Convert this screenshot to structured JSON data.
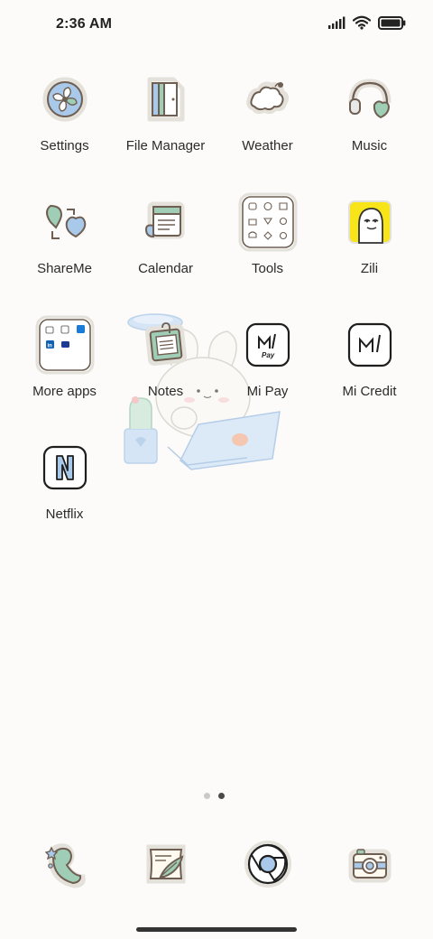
{
  "status_bar": {
    "time": "2:36 AM",
    "signal_icon": "signal-bars-icon",
    "wifi_icon": "wifi-icon",
    "battery_icon": "battery-icon"
  },
  "apps": [
    {
      "label": "Settings",
      "icon": "settings-icon"
    },
    {
      "label": "File Manager",
      "icon": "file-manager-icon"
    },
    {
      "label": "Weather",
      "icon": "weather-icon"
    },
    {
      "label": "Music",
      "icon": "music-icon"
    },
    {
      "label": "ShareMe",
      "icon": "shareme-icon"
    },
    {
      "label": "Calendar",
      "icon": "calendar-icon"
    },
    {
      "label": "Tools",
      "icon": "tools-folder-icon"
    },
    {
      "label": "Zili",
      "icon": "zili-icon"
    },
    {
      "label": "More apps",
      "icon": "more-apps-folder-icon"
    },
    {
      "label": "Notes",
      "icon": "notes-icon"
    },
    {
      "label": "Mi Pay",
      "icon": "mi-pay-icon",
      "icon_text": "Pay"
    },
    {
      "label": "Mi Credit",
      "icon": "mi-credit-icon"
    },
    {
      "label": "Netflix",
      "icon": "netflix-icon"
    }
  ],
  "page_indicator": {
    "total": 2,
    "current": 2
  },
  "dock": [
    {
      "icon": "phone-icon"
    },
    {
      "icon": "messages-icon"
    },
    {
      "icon": "chrome-icon"
    },
    {
      "icon": "camera-icon"
    }
  ],
  "colors": {
    "background": "#fcfbf9",
    "mint": "#9fcdb6",
    "sky": "#a9c9ea",
    "outline": "#7a6a5a",
    "zili_yellow": "#f7e51a"
  }
}
